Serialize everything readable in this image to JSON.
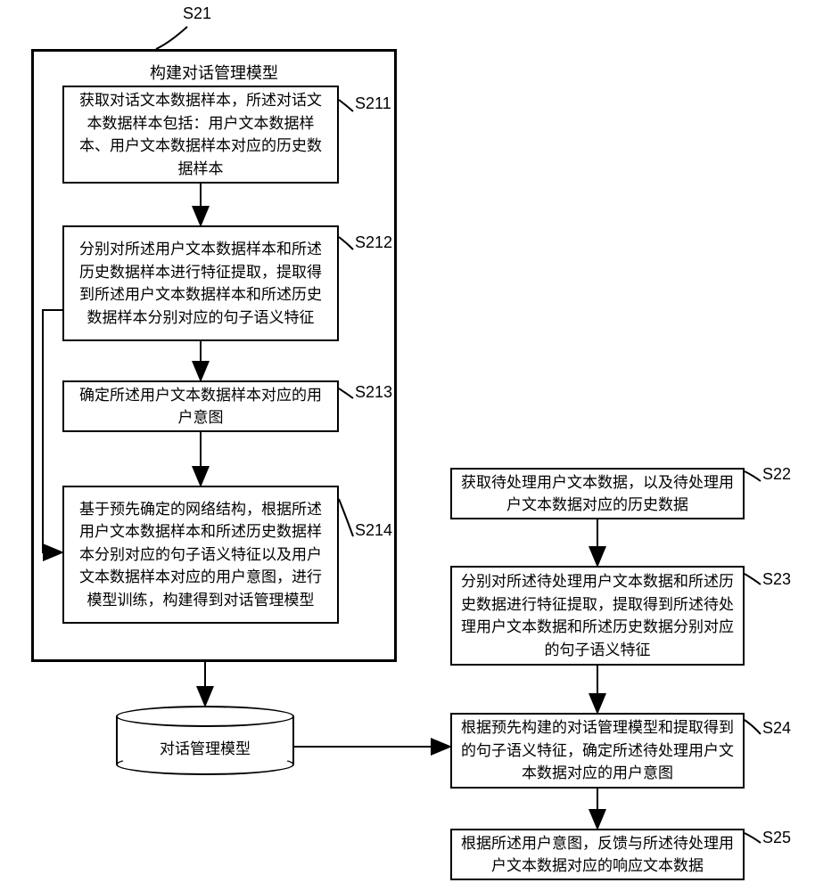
{
  "outer": {
    "label": "S21",
    "title": "构建对话管理模型",
    "steps": [
      {
        "label": "S211",
        "text": "获取对话文本数据样本，所述对话文本数据样本包括：用户文本数据样本、用户文本数据样本对应的历史数据样本"
      },
      {
        "label": "S212",
        "text": "分别对所述用户文本数据样本和所述历史数据样本进行特征提取，提取得到所述用户文本数据样本和所述历史数据样本分别对应的句子语义特征"
      },
      {
        "label": "S213",
        "text": "确定所述用户文本数据样本对应的用户意图"
      },
      {
        "label": "S214",
        "text": "基于预先确定的网络结构，根据所述用户文本数据样本和所述历史数据样本分别对应的句子语义特征以及用户文本数据样本对应的用户意图，进行模型训练，构建得到对话管理模型"
      }
    ]
  },
  "cylinder": {
    "text": "对话管理模型"
  },
  "right": [
    {
      "label": "S22",
      "text": "获取待处理用户文本数据，以及待处理用户文本数据对应的历史数据"
    },
    {
      "label": "S23",
      "text": "分别对所述待处理用户文本数据和所述历史数据进行特征提取，提取得到所述待处理用户文本数据和所述历史数据分别对应的句子语义特征"
    },
    {
      "label": "S24",
      "text": "根据预先构建的对话管理模型和提取得到的句子语义特征，确定所述待处理用户文本数据对应的用户意图"
    },
    {
      "label": "S25",
      "text": "根据所述用户意图，反馈与所述待处理用户文本数据对应的响应文本数据"
    }
  ]
}
